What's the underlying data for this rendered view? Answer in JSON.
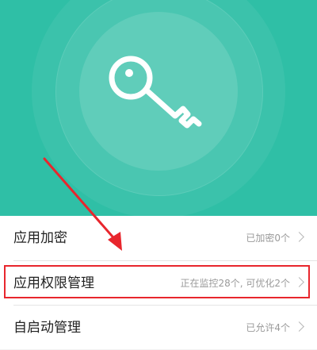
{
  "hero": {
    "icon": "key-icon",
    "accent_color": "#2fbfa6"
  },
  "list": {
    "items": [
      {
        "label": "应用加密",
        "status": "已加密0个"
      },
      {
        "label": "应用权限管理",
        "status": "正在监控28个, 可优化2个"
      },
      {
        "label": "自启动管理",
        "status": "已允许4个"
      }
    ]
  },
  "annotation": {
    "highlight_color": "#e8262d"
  }
}
